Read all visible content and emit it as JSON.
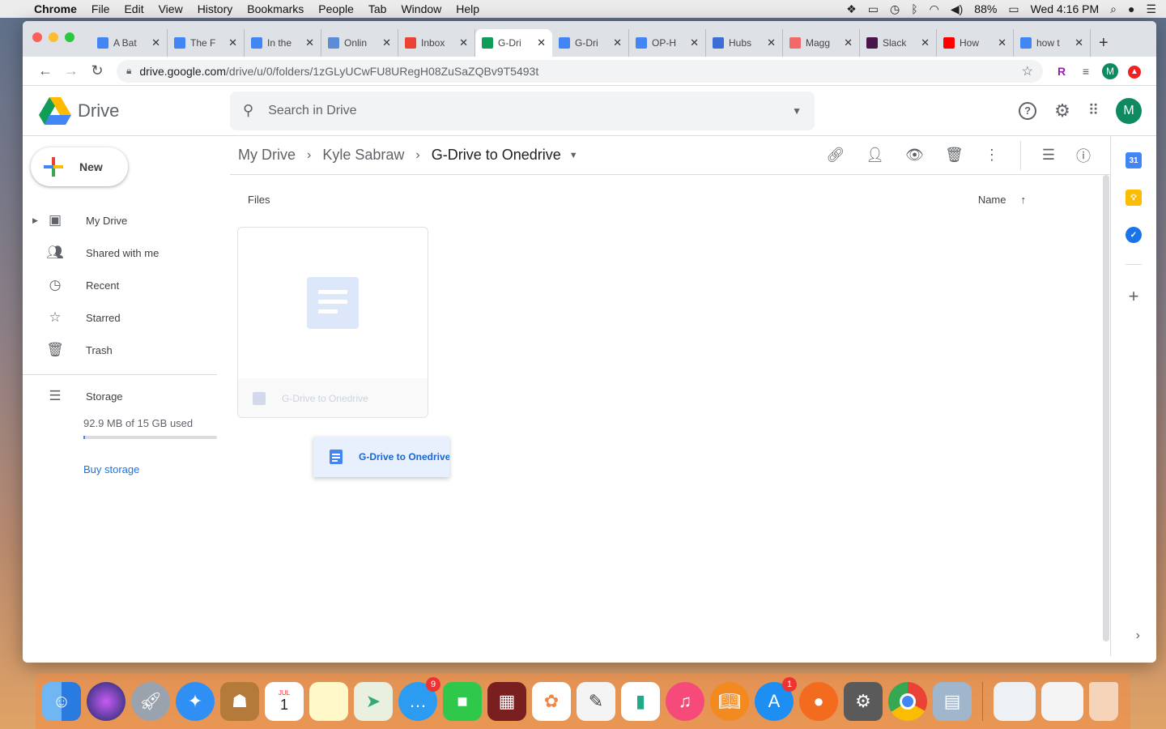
{
  "menubar": {
    "items": [
      "Chrome",
      "File",
      "Edit",
      "View",
      "History",
      "Bookmarks",
      "People",
      "Tab",
      "Window",
      "Help"
    ],
    "battery": "88%",
    "clock": "Wed 4:16 PM"
  },
  "tabs": [
    {
      "title": "A Bat",
      "icon": "docs-icon",
      "color": "#4285f4"
    },
    {
      "title": "The F",
      "icon": "docs-icon",
      "color": "#4285f4"
    },
    {
      "title": "In the",
      "icon": "docs-icon",
      "color": "#4285f4"
    },
    {
      "title": "Onlin",
      "icon": "globe-icon",
      "color": "#5b8dd6"
    },
    {
      "title": "Inbox",
      "icon": "gmail-icon",
      "color": "#ea4335"
    },
    {
      "title": "G-Dri",
      "icon": "drive-icon",
      "color": "#0f9d58",
      "active": true
    },
    {
      "title": "G-Dri",
      "icon": "docs-icon",
      "color": "#4285f4"
    },
    {
      "title": "OP-H",
      "icon": "docs-icon",
      "color": "#4285f4"
    },
    {
      "title": "Hubs",
      "icon": "hubs-icon",
      "color": "#3b6fd6"
    },
    {
      "title": "Magg",
      "icon": "asana-icon",
      "color": "#f06a6a"
    },
    {
      "title": "Slack",
      "icon": "slack-icon",
      "color": "#4a154b"
    },
    {
      "title": "How",
      "icon": "youtube-icon",
      "color": "#ff0000"
    },
    {
      "title": "how t",
      "icon": "google-icon",
      "color": "#4285f4"
    }
  ],
  "address": {
    "host": "drive.google.com",
    "path": "/drive/u/0/folders/1zGLyUCwFU8URegH08ZuSaZQBv9T5493t"
  },
  "drive": {
    "app_name": "Drive",
    "search_placeholder": "Search in Drive",
    "avatar_letter": "M",
    "new_label": "New",
    "nav": [
      {
        "label": "My Drive",
        "icon": "my-drive-icon"
      },
      {
        "label": "Shared with me",
        "icon": "shared-icon"
      },
      {
        "label": "Recent",
        "icon": "clock-icon"
      },
      {
        "label": "Starred",
        "icon": "star-icon"
      },
      {
        "label": "Trash",
        "icon": "trash-icon"
      }
    ],
    "storage_label": "Storage",
    "storage_used": "92.9 MB of 15 GB used",
    "storage_fraction": 0.006,
    "buy_storage": "Buy storage",
    "breadcrumb": [
      "My Drive",
      "Kyle Sabraw",
      "G-Drive to Onedrive"
    ],
    "files_label": "Files",
    "sort_label": "Name",
    "file_card_name": "G-Drive to Onedrive",
    "drag_chip_name": "G-Drive to Onedrive"
  },
  "dock": {
    "messages_badge": "9",
    "appstore_badge": "1",
    "calendar_month": "JUL",
    "calendar_day": "1"
  }
}
